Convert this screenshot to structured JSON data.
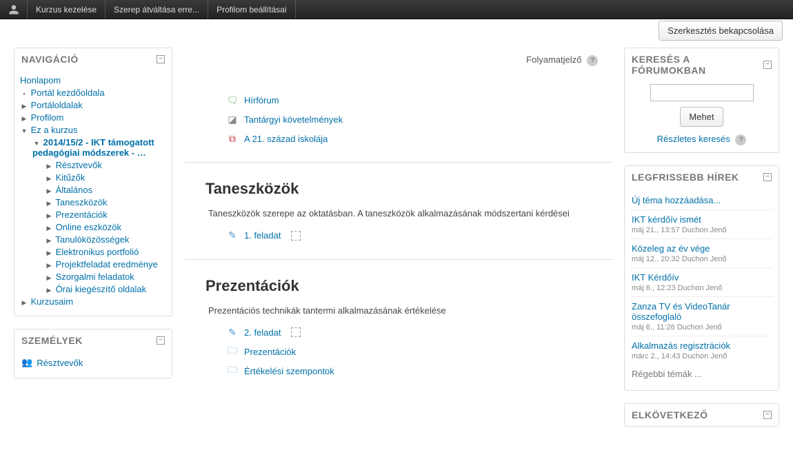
{
  "topbar": {
    "items": [
      "Kurzus kezelése",
      "Szerep átváltása erre...",
      "Profilom beállításai"
    ]
  },
  "edit_button": "Szerkesztés bekapcsolása",
  "nav_block": {
    "title": "NAVIGÁCIÓ",
    "home": "Honlapom",
    "items": {
      "portal": "Portál kezdőoldala",
      "pages": "Portáloldalak",
      "profile": "Profilom",
      "this_course": "Ez a kurzus",
      "course_name": "2014/15/2 - IKT támogatott pedagógiai módszerek - …",
      "sub": [
        "Résztvevők",
        "Kitűzők",
        "Általános",
        "Taneszközök",
        "Prezentációk",
        "Online eszközök",
        "Tanulóközösségek",
        "Elektronikus portfolió",
        "Projektfeladat eredménye",
        "Szorgalmi feladatok",
        "Órai kiegészítő oldalak"
      ],
      "my_courses": "Kurzusaim"
    }
  },
  "people_block": {
    "title": "SZEMÉLYEK",
    "link": "Résztvevők"
  },
  "progress_label": "Folyamatjelző",
  "intro_activities": [
    {
      "icon": "forum",
      "label": "Hírfórum"
    },
    {
      "icon": "doc",
      "label": "Tantárgyi követelmények"
    },
    {
      "icon": "pdf",
      "label": "A 21. század iskolája"
    }
  ],
  "sections": [
    {
      "title": "Taneszközök",
      "desc": "Taneszközök szerepe az oktatásban. A taneszközök alkalmazásának módszertani kérdései",
      "activities": [
        {
          "icon": "assign",
          "label": "1. feladat",
          "completion": true
        }
      ]
    },
    {
      "title": "Prezentációk",
      "desc": "Prezentációs technikák tantermi alkalmazásának értékelése",
      "activities": [
        {
          "icon": "assign",
          "label": "2. feladat",
          "completion": true
        },
        {
          "icon": "folder",
          "label": "Prezentációk"
        },
        {
          "icon": "folder",
          "label": "Értékelési szempontok"
        }
      ]
    }
  ],
  "search_block": {
    "title": "KERESÉS A FÓRUMOKBAN",
    "go": "Mehet",
    "advanced": "Részletes keresés"
  },
  "news_block": {
    "title": "LEGFRISSEBB HÍREK",
    "add": "Új téma hozzáadása...",
    "items": [
      {
        "title": "IKT kérdőív ismét",
        "meta": "máj 21., 13:57 Duchon Jenő"
      },
      {
        "title": "Közeleg az év vége",
        "meta": "máj 12., 20:32 Duchon Jenő"
      },
      {
        "title": "IKT Kérdőív",
        "meta": "máj 6., 12:23 Duchon Jenő"
      },
      {
        "title": "Zanza TV és VideoTanár összefoglaló",
        "meta": "máj 6., 11:26 Duchon Jenő"
      },
      {
        "title": "Alkalmazás regisztrációk",
        "meta": "márc 2., 14:43 Duchon Jenő"
      }
    ],
    "older": "Régebbi témák ..."
  },
  "upcoming_block": {
    "title": "ELKÖVETKEZŐ"
  }
}
